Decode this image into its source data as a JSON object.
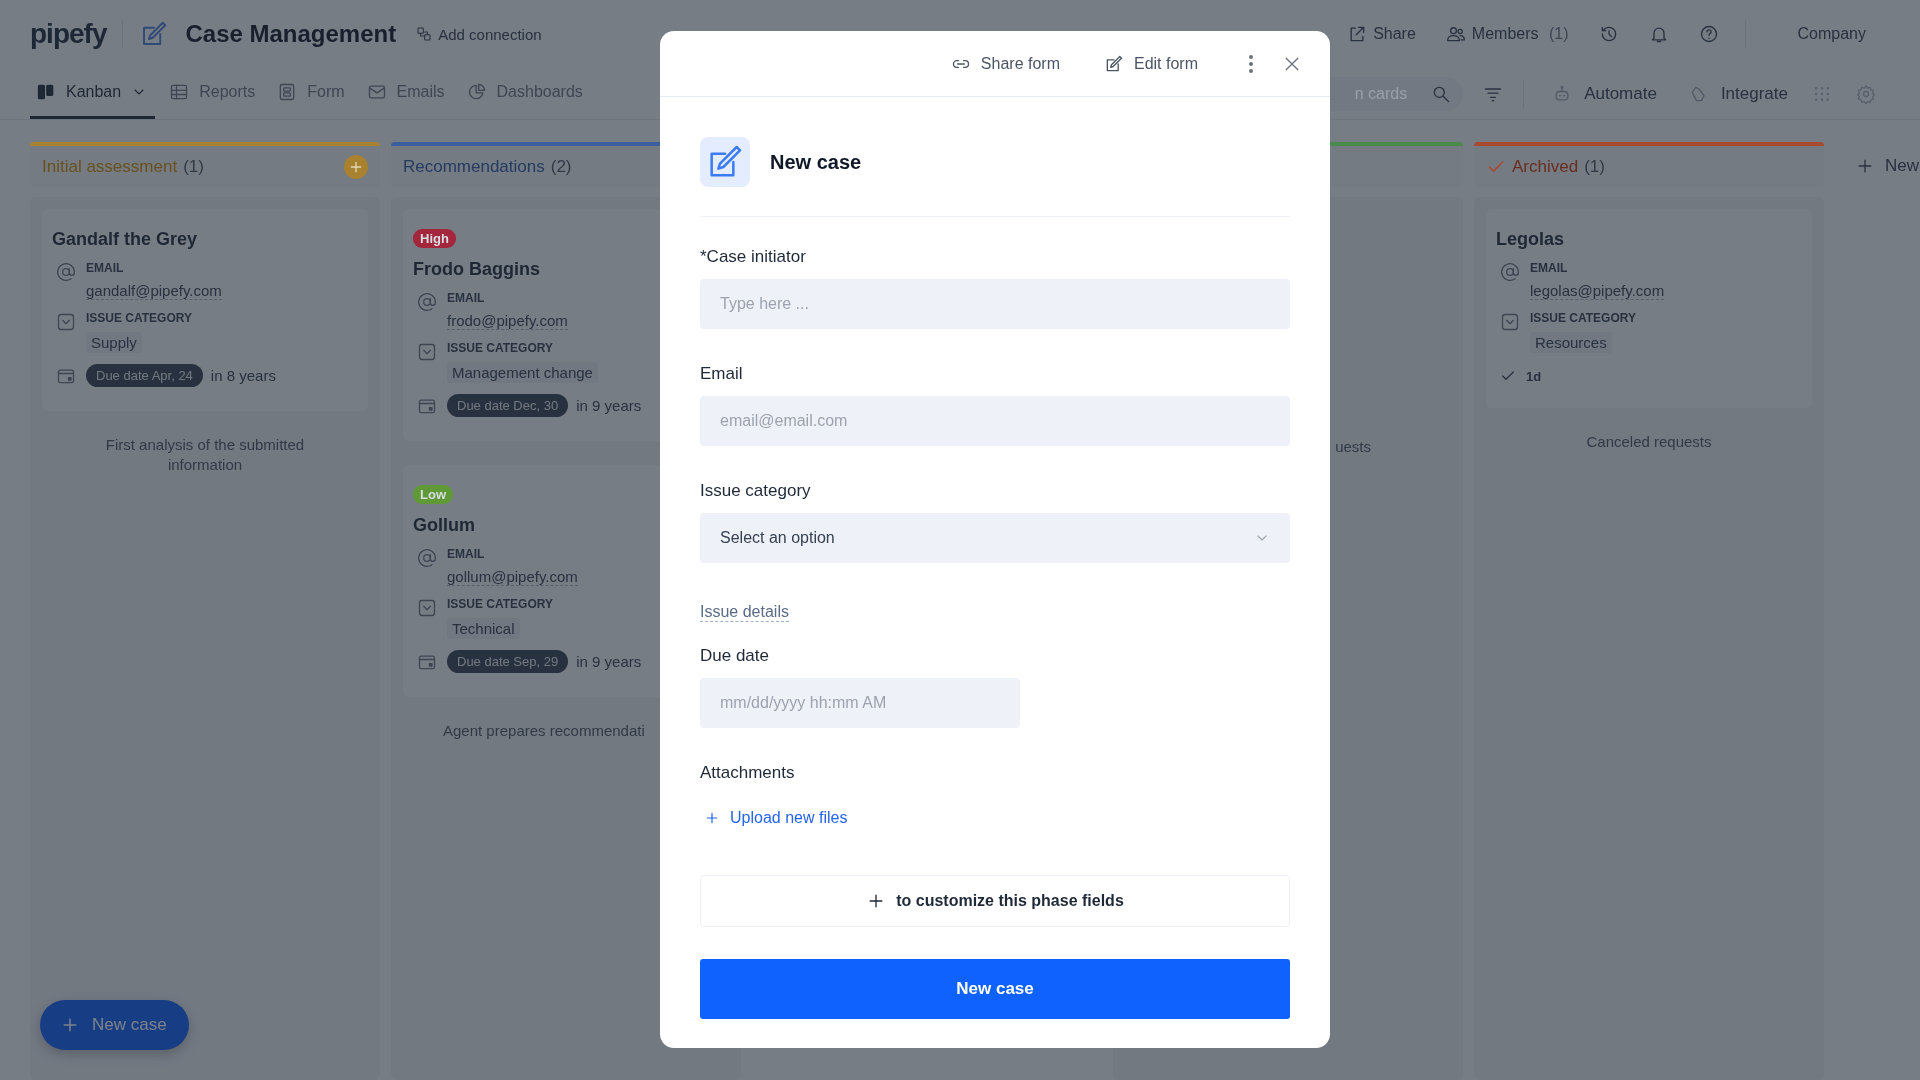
{
  "app_header": {
    "logo": "pipefy",
    "title": "Case Management",
    "add_connection": "Add connection",
    "actions": [
      {
        "kind": "share",
        "label": "Share"
      },
      {
        "kind": "members",
        "label": "Members",
        "count": "(1)"
      },
      {
        "kind": "history"
      },
      {
        "kind": "notifications"
      },
      {
        "kind": "help"
      }
    ],
    "organization": "Company"
  },
  "view_tabs": [
    {
      "kind": "kanban",
      "label": "Kanban",
      "selected": true,
      "dropdown": true
    },
    {
      "kind": "reports",
      "label": "Reports",
      "selected": false
    },
    {
      "kind": "form",
      "label": "Form",
      "selected": false
    },
    {
      "kind": "emails",
      "label": "Emails",
      "selected": false
    },
    {
      "kind": "dashboards",
      "label": "Dashboards",
      "selected": false
    }
  ],
  "toolbar": {
    "search_placeholder": "n cards",
    "actions": [
      {
        "kind": "automate",
        "label": "Automate"
      },
      {
        "kind": "integrate",
        "label": "Integrate"
      }
    ]
  },
  "phases": [
    {
      "title": "Initial assessment",
      "count": "(1)",
      "color": "#a8822f",
      "add_button": true,
      "done": false,
      "description": "First analysis of the submitted information",
      "cards": [
        {
          "name": "Gandalf the Grey",
          "fields": [
            {
              "kind": "email",
              "label": "EMAIL",
              "value": "gandalf@pipefy.com"
            },
            {
              "kind": "select",
              "label": "ISSUE CATEGORY",
              "value": "Supply"
            }
          ],
          "due": {
            "label": "Due date Apr, 24",
            "relative": "in 8 years"
          }
        }
      ]
    },
    {
      "title": "Recommendations",
      "count": "(2)",
      "color": "#3a5f9e",
      "add_button": false,
      "done": false,
      "description": "Agent prepares recommendati",
      "cards": [
        {
          "priority": {
            "label": "High",
            "color": "#a3263c"
          },
          "name": "Frodo Baggins",
          "fields": [
            {
              "kind": "email",
              "label": "EMAIL",
              "value": "frodo@pipefy.com"
            },
            {
              "kind": "select",
              "label": "ISSUE CATEGORY",
              "value": "Management change"
            }
          ],
          "due": {
            "label": "Due date Dec, 30",
            "relative": "in 9 years"
          }
        },
        {
          "priority": {
            "label": "Low",
            "color": "#5f9a36"
          },
          "name": "Gollum",
          "fields": [
            {
              "kind": "email",
              "label": "EMAIL",
              "value": "gollum@pipefy.com"
            },
            {
              "kind": "select",
              "label": "ISSUE CATEGORY",
              "value": "Technical"
            }
          ],
          "due": {
            "label": "Due date Sep, 29",
            "relative": "in 9 years"
          }
        }
      ]
    },
    {
      "color": "#4a8a4c",
      "add_button": false,
      "done": false,
      "description": "uests"
    },
    {
      "title": "Archived",
      "count": "(1)",
      "color": "#a84a32",
      "add_button": false,
      "done": true,
      "description": "Canceled requests",
      "cards": [
        {
          "name": "Legolas",
          "fields": [
            {
              "kind": "email",
              "label": "EMAIL",
              "value": "legolas@pipefy.com"
            },
            {
              "kind": "select",
              "label": "ISSUE CATEGORY",
              "value": "Resources"
            }
          ],
          "completed": "1d"
        }
      ]
    }
  ],
  "new_phase": "New",
  "fab": {
    "label": "New case"
  },
  "modal": {
    "actions": [
      {
        "kind": "share",
        "label": "Share form"
      },
      {
        "kind": "edit",
        "label": "Edit form"
      },
      {
        "kind": "more"
      },
      {
        "kind": "close"
      }
    ],
    "title": "New case",
    "fields": [
      {
        "kind": "text",
        "label": "*Case initiator",
        "placeholder": "Type here ..."
      },
      {
        "kind": "text",
        "label": "Email",
        "placeholder": "email@email.com"
      },
      {
        "kind": "select",
        "label": "Issue category",
        "placeholder": "Select an option"
      },
      {
        "kind": "section",
        "label": "Issue details"
      },
      {
        "kind": "datetime",
        "label": "Due date",
        "placeholder": "mm/dd/yyyy hh:mm AM"
      },
      {
        "kind": "attachments",
        "label": "Attachments",
        "action": "Upload new files"
      }
    ],
    "customize": "to customize this phase fields",
    "submit": "New case"
  }
}
